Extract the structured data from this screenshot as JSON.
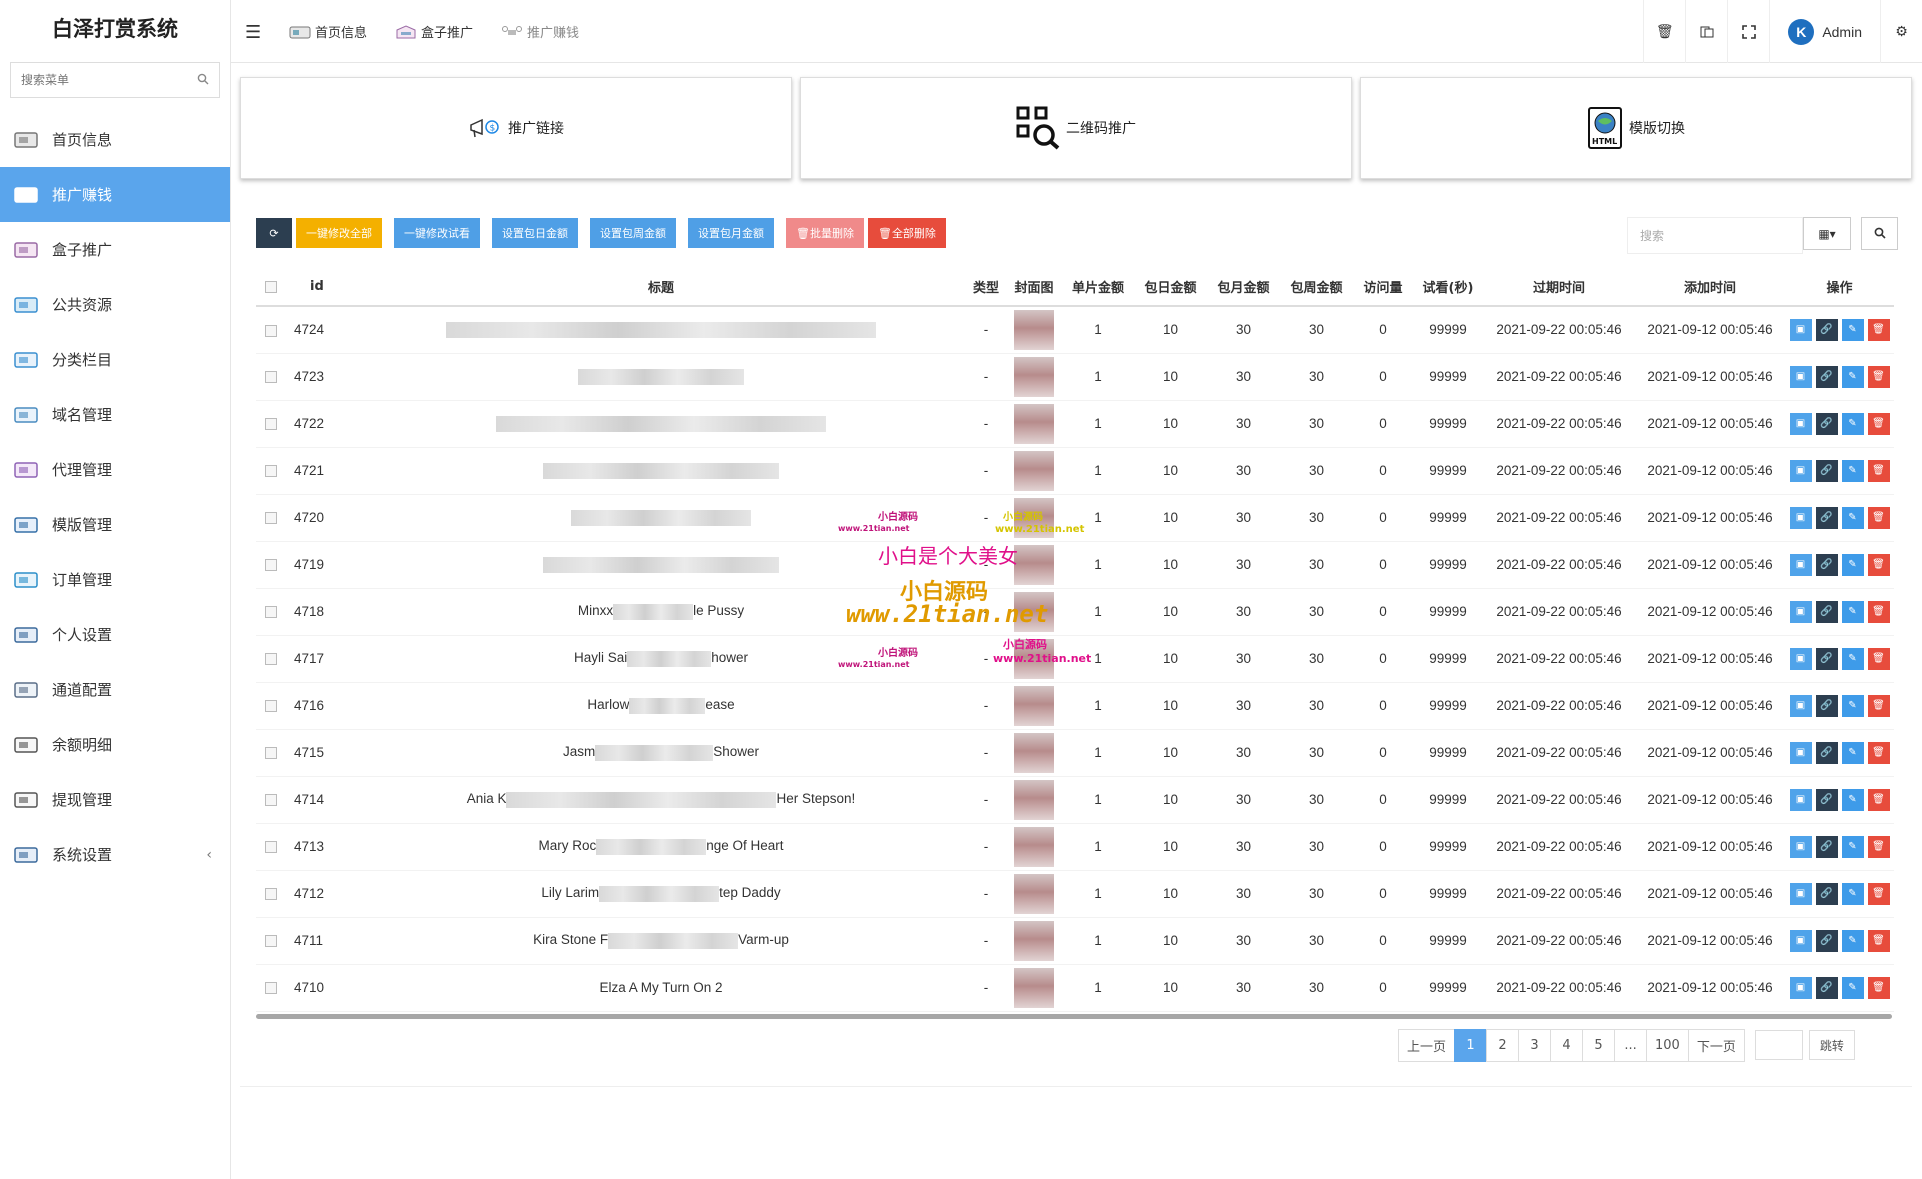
{
  "brand": "白泽打赏系统",
  "sidebar": {
    "search_placeholder": "搜索菜单",
    "items": [
      {
        "label": "首页信息"
      },
      {
        "label": "推广赚钱"
      },
      {
        "label": "盒子推广"
      },
      {
        "label": "公共资源"
      },
      {
        "label": "分类栏目"
      },
      {
        "label": "域名管理"
      },
      {
        "label": "代理管理"
      },
      {
        "label": "模版管理"
      },
      {
        "label": "订单管理"
      },
      {
        "label": "个人设置"
      },
      {
        "label": "通道配置"
      },
      {
        "label": "余额明细"
      },
      {
        "label": "提现管理"
      },
      {
        "label": "系统设置"
      }
    ]
  },
  "header": {
    "tabs": [
      {
        "label": "首页信息"
      },
      {
        "label": "盒子推广"
      },
      {
        "label": "推广赚钱"
      }
    ],
    "user": "Admin"
  },
  "cards": [
    {
      "label": "推广链接"
    },
    {
      "label": "二维码推广"
    },
    {
      "label": "模版切换"
    }
  ],
  "toolbar": {
    "btn_one_all": "一键修改全部",
    "btn_one_trial": "一键修改试看",
    "btn_day": "设置包日金额",
    "btn_week": "设置包周金额",
    "btn_month": "设置包月金额",
    "btn_batch_delete": "批量删除",
    "btn_delete_all": "全部删除",
    "search_placeholder": "搜索"
  },
  "table": {
    "headers": {
      "id": "id",
      "title": "标题",
      "type": "类型",
      "cover": "封面图",
      "single": "单片金额",
      "day": "包日金额",
      "month": "包月金额",
      "week": "包周金额",
      "visits": "访问量",
      "trial": "试看(秒)",
      "expire": "过期时间",
      "added": "添加时间",
      "ops": "操作"
    },
    "rows": [
      {
        "id": "4724",
        "title_pre": "",
        "title_post": "",
        "type": "-",
        "single": "1",
        "day": "10",
        "month": "30",
        "week": "30",
        "visits": "0",
        "trial": "99999",
        "expire": "2021-09-22 00:05:46",
        "added": "2021-09-12 00:05:46"
      },
      {
        "id": "4723",
        "title_pre": "",
        "title_post": "",
        "type": "-",
        "single": "1",
        "day": "10",
        "month": "30",
        "week": "30",
        "visits": "0",
        "trial": "99999",
        "expire": "2021-09-22 00:05:46",
        "added": "2021-09-12 00:05:46"
      },
      {
        "id": "4722",
        "title_pre": "",
        "title_post": "",
        "type": "-",
        "single": "1",
        "day": "10",
        "month": "30",
        "week": "30",
        "visits": "0",
        "trial": "99999",
        "expire": "2021-09-22 00:05:46",
        "added": "2021-09-12 00:05:46"
      },
      {
        "id": "4721",
        "title_pre": "",
        "title_post": "",
        "type": "-",
        "single": "1",
        "day": "10",
        "month": "30",
        "week": "30",
        "visits": "0",
        "trial": "99999",
        "expire": "2021-09-22 00:05:46",
        "added": "2021-09-12 00:05:46"
      },
      {
        "id": "4720",
        "title_pre": "",
        "title_post": "",
        "type": "-",
        "single": "1",
        "day": "10",
        "month": "30",
        "week": "30",
        "visits": "0",
        "trial": "99999",
        "expire": "2021-09-22 00:05:46",
        "added": "2021-09-12 00:05:46"
      },
      {
        "id": "4719",
        "title_pre": "",
        "title_post": "",
        "type": "-",
        "single": "1",
        "day": "10",
        "month": "30",
        "week": "30",
        "visits": "0",
        "trial": "99999",
        "expire": "2021-09-22 00:05:46",
        "added": "2021-09-12 00:05:46"
      },
      {
        "id": "4718",
        "title_pre": "Minxx",
        "title_post": "le Pussy",
        "type": "-",
        "single": "1",
        "day": "10",
        "month": "30",
        "week": "30",
        "visits": "0",
        "trial": "99999",
        "expire": "2021-09-22 00:05:46",
        "added": "2021-09-12 00:05:46"
      },
      {
        "id": "4717",
        "title_pre": "Hayli Sai",
        "title_post": "hower",
        "type": "-",
        "single": "1",
        "day": "10",
        "month": "30",
        "week": "30",
        "visits": "0",
        "trial": "99999",
        "expire": "2021-09-22 00:05:46",
        "added": "2021-09-12 00:05:46"
      },
      {
        "id": "4716",
        "title_pre": "Harlow",
        "title_post": "ease",
        "type": "-",
        "single": "1",
        "day": "10",
        "month": "30",
        "week": "30",
        "visits": "0",
        "trial": "99999",
        "expire": "2021-09-22 00:05:46",
        "added": "2021-09-12 00:05:46"
      },
      {
        "id": "4715",
        "title_pre": "Jasm",
        "title_post": "Shower",
        "type": "-",
        "single": "1",
        "day": "10",
        "month": "30",
        "week": "30",
        "visits": "0",
        "trial": "99999",
        "expire": "2021-09-22 00:05:46",
        "added": "2021-09-12 00:05:46"
      },
      {
        "id": "4714",
        "title_pre": "Ania K",
        "title_post": "Her Stepson!",
        "type": "-",
        "single": "1",
        "day": "10",
        "month": "30",
        "week": "30",
        "visits": "0",
        "trial": "99999",
        "expire": "2021-09-22 00:05:46",
        "added": "2021-09-12 00:05:46"
      },
      {
        "id": "4713",
        "title_pre": "Mary Roc",
        "title_post": "nge Of Heart",
        "type": "-",
        "single": "1",
        "day": "10",
        "month": "30",
        "week": "30",
        "visits": "0",
        "trial": "99999",
        "expire": "2021-09-22 00:05:46",
        "added": "2021-09-12 00:05:46"
      },
      {
        "id": "4712",
        "title_pre": "Lily Larim",
        "title_post": "tep Daddy",
        "type": "-",
        "single": "1",
        "day": "10",
        "month": "30",
        "week": "30",
        "visits": "0",
        "trial": "99999",
        "expire": "2021-09-22 00:05:46",
        "added": "2021-09-12 00:05:46"
      },
      {
        "id": "4711",
        "title_pre": "Kira Stone F",
        "title_post": "Varm-up",
        "type": "-",
        "single": "1",
        "day": "10",
        "month": "30",
        "week": "30",
        "visits": "0",
        "trial": "99999",
        "expire": "2021-09-22 00:05:46",
        "added": "2021-09-12 00:05:46"
      },
      {
        "id": "4710",
        "title_pre": "Elza A My Turn On 2",
        "title_post": "",
        "type": "-",
        "single": "1",
        "day": "10",
        "month": "30",
        "week": "30",
        "visits": "0",
        "trial": "99999",
        "expire": "2021-09-22 00:05:46",
        "added": "2021-09-12 00:05:46"
      }
    ]
  },
  "pagination": {
    "prev": "上一页",
    "pages": [
      "1",
      "2",
      "3",
      "4",
      "5",
      "...",
      "100"
    ],
    "next": "下一页",
    "jump": "跳转"
  },
  "watermark": {
    "line1": "小白是个大美女",
    "line2": "小白源码",
    "line3": "www.21tian.net",
    "small_cn": "小白源码",
    "small_url": "www.21tian.net"
  }
}
